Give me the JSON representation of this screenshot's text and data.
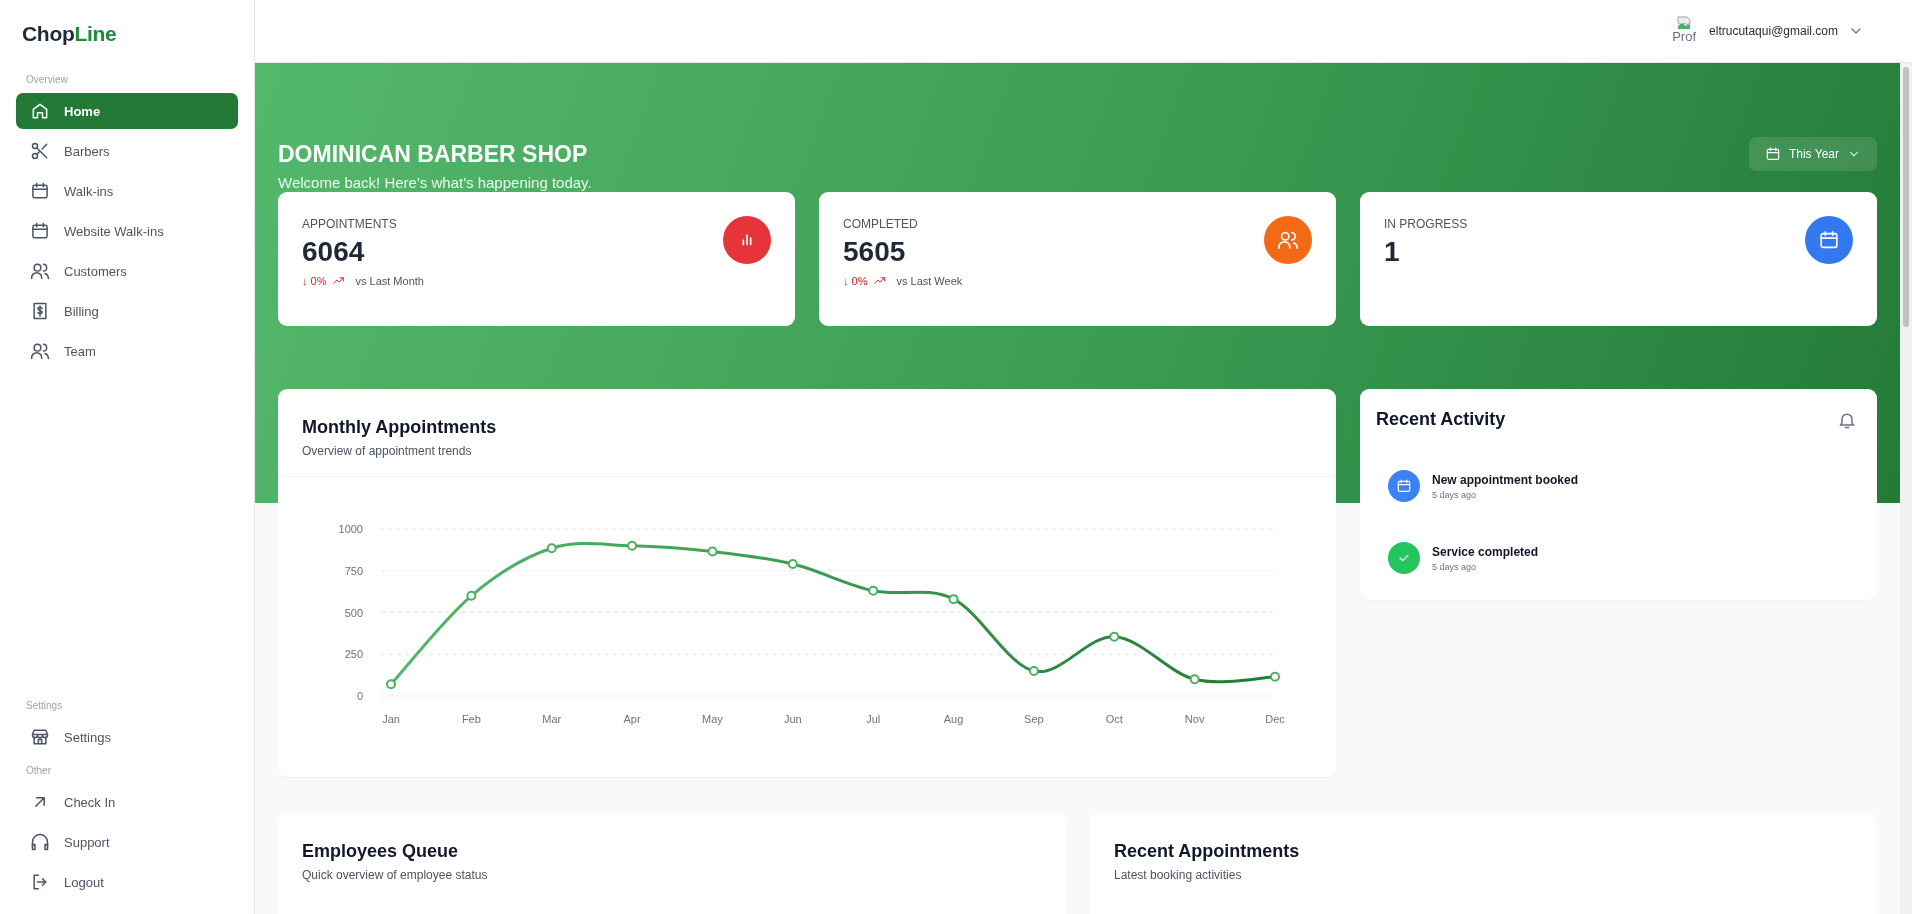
{
  "brand": {
    "name": "Chop",
    "accent": "Line"
  },
  "sidebar": {
    "sections": [
      {
        "title": "Overview",
        "items": [
          {
            "label": "Home",
            "selected": true
          },
          {
            "label": "Barbers",
            "selected": false
          },
          {
            "label": "Walk-ins",
            "selected": false
          },
          {
            "label": "Website Walk-ins",
            "selected": false
          },
          {
            "label": "Customers",
            "selected": false
          },
          {
            "label": "Billing",
            "selected": false
          },
          {
            "label": "Team",
            "selected": false
          }
        ]
      },
      {
        "title": "Settings",
        "items": [
          {
            "label": "Settings",
            "selected": false
          }
        ]
      },
      {
        "title": "Other",
        "items": [
          {
            "label": "Check In",
            "selected": false
          },
          {
            "label": "Support",
            "selected": false
          },
          {
            "label": "Logout",
            "selected": false
          }
        ]
      }
    ]
  },
  "header": {
    "avatar_alt": "Prof",
    "email": "eltrucutaqui@gmail.com"
  },
  "banner": {
    "title": "DOMINICAN BARBER SHOP",
    "subtitle": "Welcome back! Here's what's happening today.",
    "period": "This Year"
  },
  "stats": [
    {
      "label": "APPOINTMENTS",
      "value": "6064",
      "change": "↓ 0%",
      "comparison": "vs Last Month",
      "color": "#e5343a"
    },
    {
      "label": "COMPLETED",
      "value": "5605",
      "change": "↓ 0%",
      "comparison": "vs Last Week",
      "color": "#f26a15"
    },
    {
      "label": "IN PROGRESS",
      "value": "1",
      "color": "#3478f0"
    }
  ],
  "monthly": {
    "title": "Monthly Appointments",
    "subtitle": "Overview of appointment trends",
    "chart_data": {
      "type": "line",
      "categories": [
        "Jan",
        "Feb",
        "Mar",
        "Apr",
        "May",
        "Jun",
        "Jul",
        "Aug",
        "Sep",
        "Oct",
        "Nov",
        "Dec"
      ],
      "values": [
        70,
        600,
        885,
        900,
        865,
        790,
        630,
        580,
        150,
        355,
        100,
        115
      ],
      "ylim": [
        0,
        1000
      ],
      "yticks": [
        0,
        250,
        500,
        750,
        1000
      ],
      "grid": true,
      "marker": "circle"
    }
  },
  "activity": {
    "title": "Recent Activity",
    "items": [
      {
        "title": "New appointment booked",
        "time": "5 days ago",
        "color": "#3b82f6"
      },
      {
        "title": "Service completed",
        "time": "5 days ago",
        "color": "#22c55e"
      }
    ]
  },
  "bottom_cards": [
    {
      "title": "Employees Queue",
      "subtitle": "Quick overview of employee status"
    },
    {
      "title": "Recent Appointments",
      "subtitle": "Latest booking activities"
    }
  ]
}
